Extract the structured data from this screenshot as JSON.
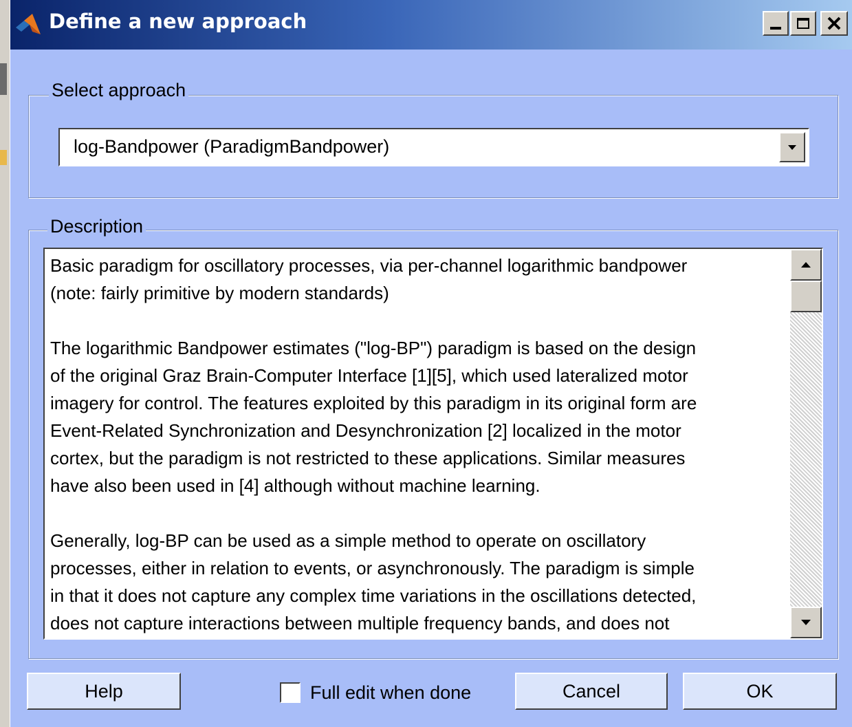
{
  "window": {
    "title": "Define a new approach",
    "controls": [
      "minimize-icon",
      "maximize-icon",
      "close-icon"
    ]
  },
  "approach_group": {
    "label": "Select approach",
    "selected": "log-Bandpower (ParadigmBandpower)"
  },
  "description_group": {
    "label": "Description",
    "text": "Basic paradigm for oscillatory processes, via per-channel logarithmic bandpower\n(note: fairly primitive by modern standards)\n\nThe logarithmic Bandpower estimates (\"log-BP\") paradigm is based on the design\nof the original Graz Brain-Computer Interface [1][5], which used lateralized motor\nimagery for control. The features exploited by this paradigm in its original form are\nEvent-Related Synchronization and Desynchronization [2] localized in the motor\ncortex, but the paradigm is not restricted to these applications. Similar measures\nhave also been used in [4] although without machine learning.\n\nGenerally, log-BP can be used as a simple method to operate on oscillatory\nprocesses, either in relation to events, or asynchronously. The paradigm is simple\nin that it does not capture any complex time variations in the oscillations detected,\ndoes not capture interactions between multiple frequency bands, and does not\nmake intelligent adaptive decisions in the preprocessing or feature extraction (the machine"
  },
  "buttons": {
    "help": "Help",
    "cancel": "Cancel",
    "ok": "OK"
  },
  "full_edit": {
    "label": "Full edit when done",
    "checked": false
  }
}
